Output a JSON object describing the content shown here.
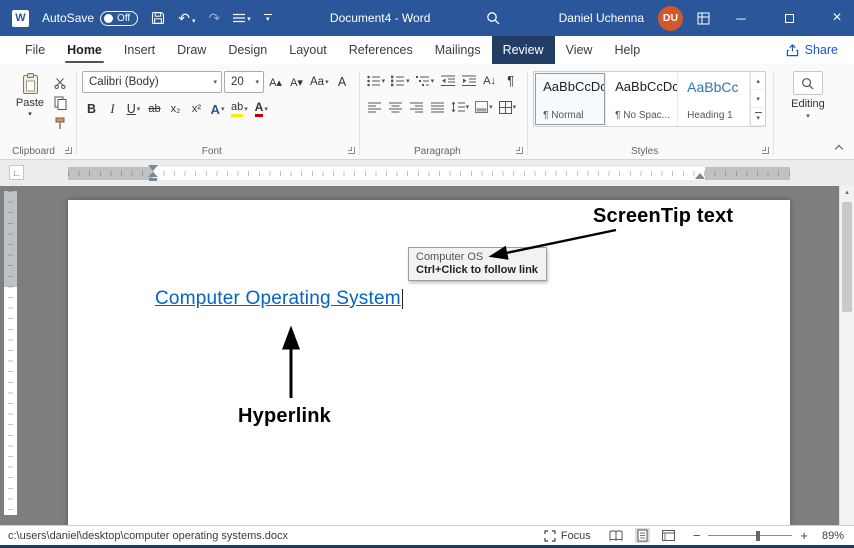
{
  "colors": {
    "titlebar_bg": "#2b579a",
    "accent_blue": "#185abd",
    "hyperlink": "#0563c1",
    "avatar_bg": "#d1582b",
    "heading_style_blue": "#2e74b5",
    "document_bg": "#7e7e7e",
    "review_tab_bg": "#223e66",
    "highlight_yellow": "#ffe900",
    "font_color_red": "#c00000"
  },
  "titlebar": {
    "autosave_label": "AutoSave",
    "autosave_state": "Off",
    "document_title": "Document4 - Word",
    "user_name": "Daniel Uchenna",
    "avatar_initials": "DU"
  },
  "menubar": {
    "tabs": [
      "File",
      "Home",
      "Insert",
      "Draw",
      "Design",
      "Layout",
      "References",
      "Mailings",
      "Review",
      "View",
      "Help"
    ],
    "active_tab": "Home",
    "share_label": "Share"
  },
  "ribbon": {
    "clipboard": {
      "paste_label": "Paste"
    },
    "font": {
      "font_name": "Calibri (Body)",
      "font_size": "20"
    },
    "styles_gallery": [
      {
        "preview": "AaBbCcDc",
        "name": "¶ Normal"
      },
      {
        "preview": "AaBbCcDc",
        "name": "¶ No Spac..."
      },
      {
        "preview": "AaBbCc",
        "name": "Heading 1"
      }
    ],
    "editing_label": "Editing",
    "group_labels": {
      "clipboard": "Clipboard",
      "font": "Font",
      "paragraph": "Paragraph",
      "styles": "Styles"
    }
  },
  "icons": {
    "word_logo": "W",
    "undo": "↶",
    "redo": "↷",
    "dropdown": "▾",
    "triangle_up": "▴",
    "bold": "B",
    "italic": "I",
    "underline": "U",
    "strikethrough": "ab",
    "subscript": "x₂",
    "superscript": "x²",
    "text_effects": "A",
    "highlight": "ab",
    "font_color": "A",
    "grow_font": "A▴",
    "shrink_font": "A▾",
    "change_case": "Aa",
    "clear_formatting": "A",
    "sort": "A↓",
    "pilcrow": "¶",
    "minimize": "─",
    "close": "×",
    "zoom_out": "−",
    "zoom_in": "+",
    "tab_selector": "∟",
    "scroll_up": "▴"
  },
  "document": {
    "hyperlink_text": "Computer Operating System",
    "screentip": {
      "title": "Computer OS",
      "instruction": "Ctrl+Click to follow link"
    },
    "annotations": {
      "screentip_label": "ScreenTip text",
      "hyperlink_label": "Hyperlink"
    }
  },
  "statusbar": {
    "document_path": "c:\\users\\daniel\\desktop\\computer operating systems.docx",
    "focus_label": "Focus",
    "zoom_level": "89%"
  }
}
